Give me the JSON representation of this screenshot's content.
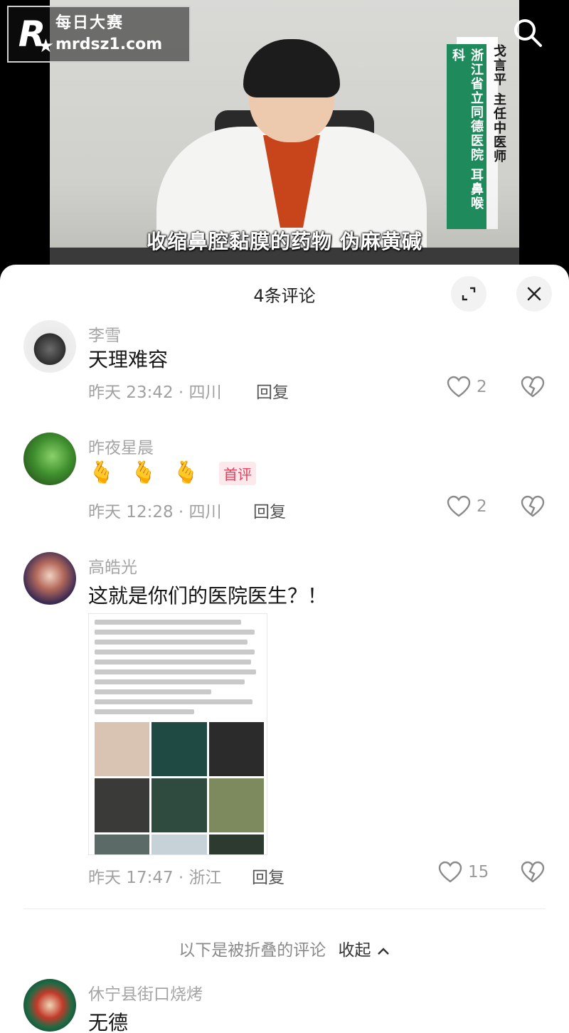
{
  "logo": {
    "mark": "R",
    "line1": "每日大赛",
    "line2": "mrdsz1.com"
  },
  "video": {
    "caption": "收缩鼻腔黏膜的药物 伪麻黄碱",
    "doctor_name_title": "戈言平  主任中医师",
    "hospital_dept": "浙江省立同德医院  耳鼻喉科"
  },
  "sheet": {
    "title": "4条评论"
  },
  "comments": [
    {
      "user": "李雪",
      "text": "天理难容",
      "time_location": "昨天 23:42 · 四川",
      "reply_label": "回复",
      "likes": "2"
    },
    {
      "user": "昨夜星晨",
      "emoji": "🫰",
      "tag": "首评",
      "time_location": "昨天 12:28 · 四川",
      "reply_label": "回复",
      "likes": "2"
    },
    {
      "user": "高皓光",
      "text": "这就是你们的医院医生？！",
      "time_location": "昨天 17:47 · 浙江",
      "reply_label": "回复",
      "likes": "15"
    },
    {
      "user": "休宁县街口烧烤",
      "text": "无德"
    }
  ],
  "folded": {
    "text": "以下是被折叠的评论",
    "collapse_label": "收起"
  },
  "colors": {
    "accent_tag": "#e6405b",
    "banner_green": "#1f8a5b"
  },
  "icons": [
    "search-icon",
    "expand-icon",
    "close-icon",
    "heart-icon",
    "broken-heart-icon",
    "chevron-up-icon"
  ]
}
